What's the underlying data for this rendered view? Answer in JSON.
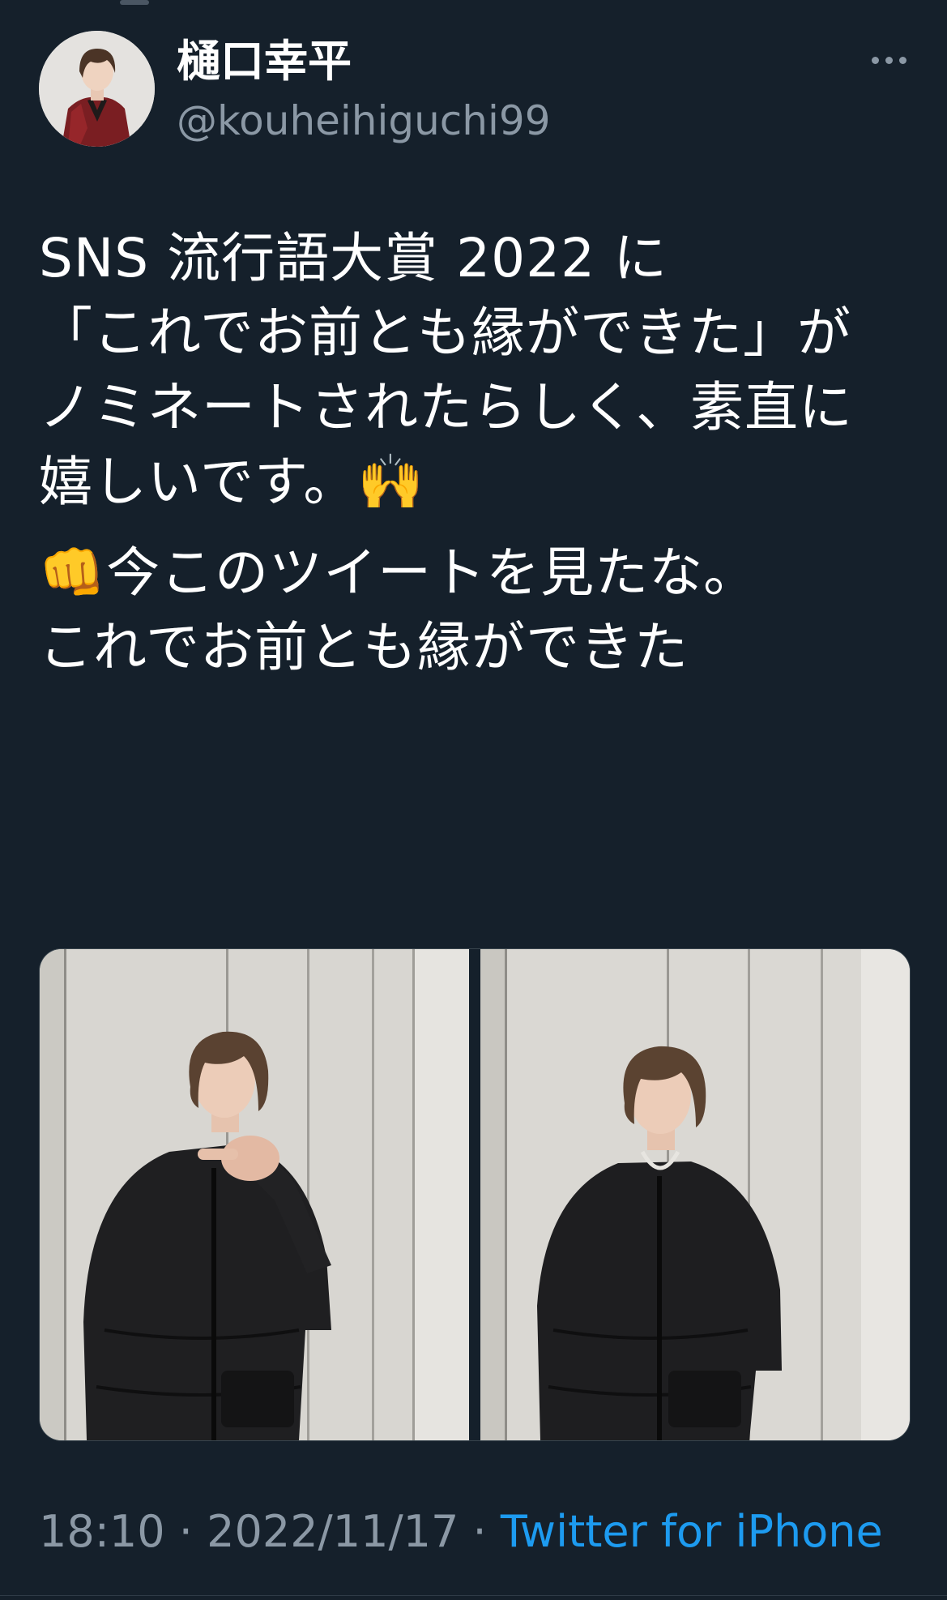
{
  "tweet": {
    "author": {
      "display_name": "樋口幸平",
      "handle": "@kouheihiguchi99"
    },
    "paragraphs": [
      "SNS 流行語大賞 2022 に\n「これでお前とも縁ができた」が\nノミネートされたらしく、素直に嬉しいです。🙌",
      "👊今このツイートを見たな。\nこれでお前とも縁ができた"
    ],
    "timestamp": {
      "time": "18:10",
      "separator": " · ",
      "date": "2022/11/17",
      "separator2": " · ",
      "source": "Twitter for iPhone"
    },
    "media": [
      {
        "alt": "photo-pointing"
      },
      {
        "alt": "photo-standing"
      }
    ]
  },
  "icons": {
    "more": "more-horizontal-icon"
  },
  "colors": {
    "background": "#15202b",
    "text": "#ffffff",
    "secondary": "#8b98a5",
    "link": "#1d9bf0"
  }
}
